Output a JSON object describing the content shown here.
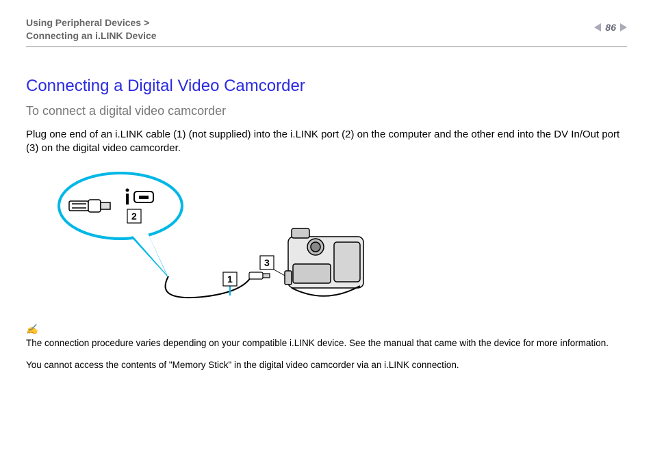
{
  "header": {
    "breadcrumb_section": "Using Peripheral Devices",
    "breadcrumb_sep": ">",
    "breadcrumb_page": "Connecting an i.LINK Device",
    "page_number": "86"
  },
  "main": {
    "title": "Connecting a Digital Video Camcorder",
    "subtitle": "To connect a digital video camcorder",
    "instruction": "Plug one end of an i.LINK cable (1) (not supplied) into the i.LINK port (2) on the computer and the other end into the DV In/Out port (3) on the digital video camcorder.",
    "note_icon": "✍",
    "note1": "The connection procedure varies depending on your compatible i.LINK device. See the manual that came with the device for more information.",
    "note2": "You cannot access the contents of \"Memory Stick\" in the digital video camcorder via an i.LINK connection."
  },
  "diagram": {
    "labels": {
      "cable": "1",
      "port": "2",
      "dvport": "3"
    }
  }
}
